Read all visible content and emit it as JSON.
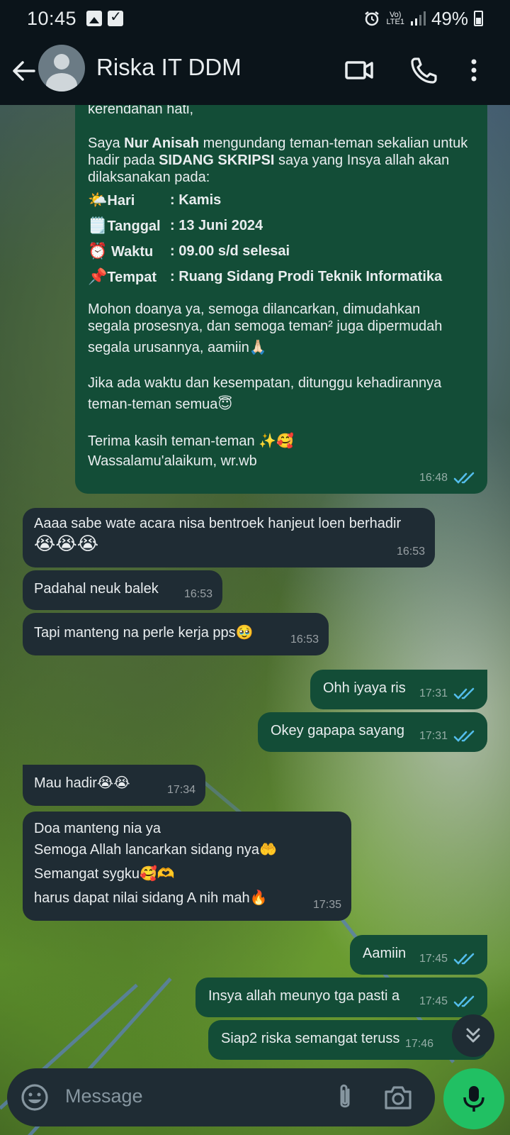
{
  "status_bar": {
    "time": "10:45",
    "network_label_top": "Vo)",
    "network_label_bottom": "LTE1",
    "battery": "49%"
  },
  "header": {
    "contact_name": "Riska IT DDM"
  },
  "messages": {
    "m0": {
      "line1": "kerendahan hati,",
      "p2_pre": "Saya ",
      "p2_name": "Nur Anisah",
      "p2_mid": " mengundang teman-teman sekalian untuk hadir pada ",
      "p2_event": "SIDANG SKRIPSI",
      "p2_post": " saya yang Insya allah akan dilaksanakan pada:",
      "hari_emoji": "🌤️",
      "hari_key": "Hari",
      "hari_val": ": Kamis",
      "tanggal_emoji": "🗒️",
      "tanggal_key": "Tanggal",
      "tanggal_val": ": 13 Juni 2024",
      "waktu_emoji": "⏰",
      "waktu_key": "Waktu",
      "waktu_val": ": 09.00 s/d selesai",
      "tempat_emoji": "📌",
      "tempat_key": "Tempat",
      "tempat_val": ": Ruang Sidang Prodi Teknik Informatika",
      "p4_1": "Mohon doanya ya, semoga dilancarkan, dimudahkan",
      "p4_2": "segala prosesnya, dan semoga teman² juga dipermudah",
      "p4_3": "segala urusannya, aamiin🙏🏻",
      "p5_1": "Jika ada waktu dan kesempatan, ditunggu kehadirannya",
      "p5_2": "teman-teman semua😇",
      "p6_1": "Terima kasih teman-teman ✨🥰",
      "p6_2": "Wassalamu'alaikum, wr.wb",
      "time": "16:48"
    },
    "m1": {
      "line1": "Aaaa sabe wate acara nisa bentroek hanjeut loen berhadir",
      "line2": "😭😭😭",
      "time": "16:53"
    },
    "m2": {
      "text": "Padahal neuk balek",
      "time": "16:53"
    },
    "m3": {
      "text": "Tapi manteng na perle kerja pps🥹",
      "time": "16:53"
    },
    "m4": {
      "text": "Ohh iyaya ris",
      "time": "17:31"
    },
    "m5": {
      "text": "Okey gapapa sayang",
      "time": "17:31"
    },
    "m6": {
      "text": "Mau hadir😭😭",
      "time": "17:34"
    },
    "m7": {
      "line1": "Doa manteng nia ya",
      "line2": "Semoga Allah lancarkan sidang nya🤲",
      "line3": "Semangat sygku🥰🫶",
      "line4": "harus dapat nilai sidang A nih mah🔥",
      "time": "17:35"
    },
    "m8": {
      "text": "Aamiin",
      "time": "17:45"
    },
    "m9": {
      "text": "Insya allah meunyo tga pasti a",
      "time": "17:45"
    },
    "m10": {
      "text": "Siap2 riska semangat teruss",
      "time": "17:46"
    }
  },
  "composer": {
    "placeholder": "Message"
  },
  "colors": {
    "outgoing_bubble": "#134d37",
    "incoming_bubble": "#1f2c34",
    "read_ticks": "#53bdeb",
    "mic_button": "#21c063"
  }
}
